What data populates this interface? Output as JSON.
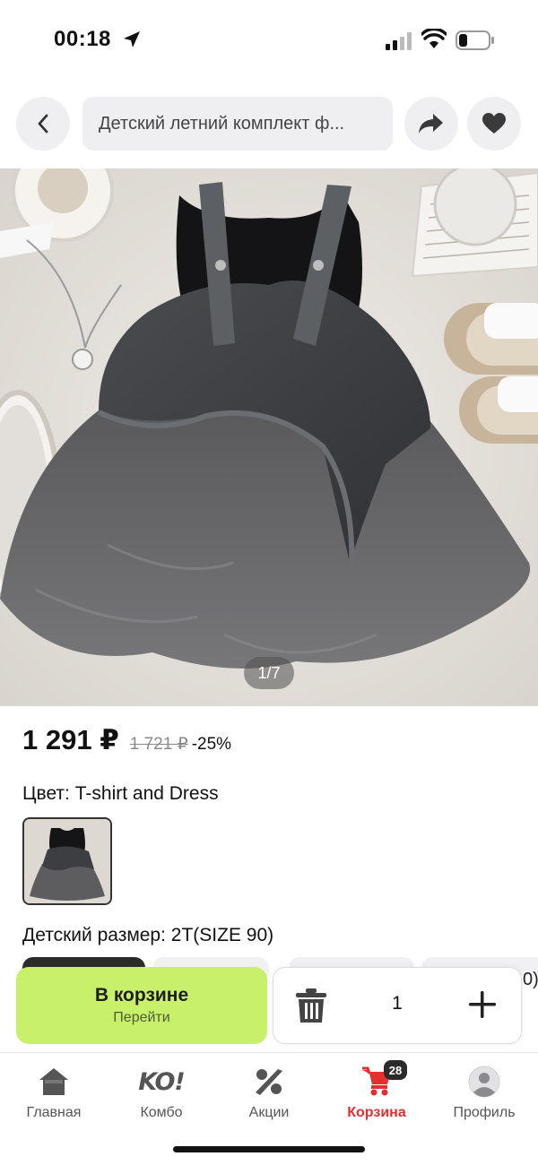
{
  "status_bar": {
    "time": "00:18"
  },
  "header": {
    "search_text": "Детский летний комплект ф..."
  },
  "gallery": {
    "counter": "1/7"
  },
  "price": {
    "current": "1 291 ₽",
    "old": "1 721 ₽",
    "discount": "-25%"
  },
  "color": {
    "label": "Цвет: T-shirt and Dress"
  },
  "size": {
    "label": "Детский размер: 2T(SIZE 90)",
    "edge_text": "0)"
  },
  "cart": {
    "button_label": "В корзине",
    "button_sub": "Перейти",
    "quantity": "1"
  },
  "tabbar": {
    "tabs": [
      {
        "label": "Главная",
        "icon": "home-icon"
      },
      {
        "label": "Комбо",
        "icon": "combo-logo",
        "logo_text": "KO!"
      },
      {
        "label": "Акции",
        "icon": "percent-icon"
      },
      {
        "label": "Корзина",
        "icon": "cart-icon",
        "badge": "28",
        "active": true
      },
      {
        "label": "Профиль",
        "icon": "profile-icon"
      }
    ]
  },
  "colors": {
    "accent_green": "#c8f06b",
    "active_red": "#e3302f"
  }
}
